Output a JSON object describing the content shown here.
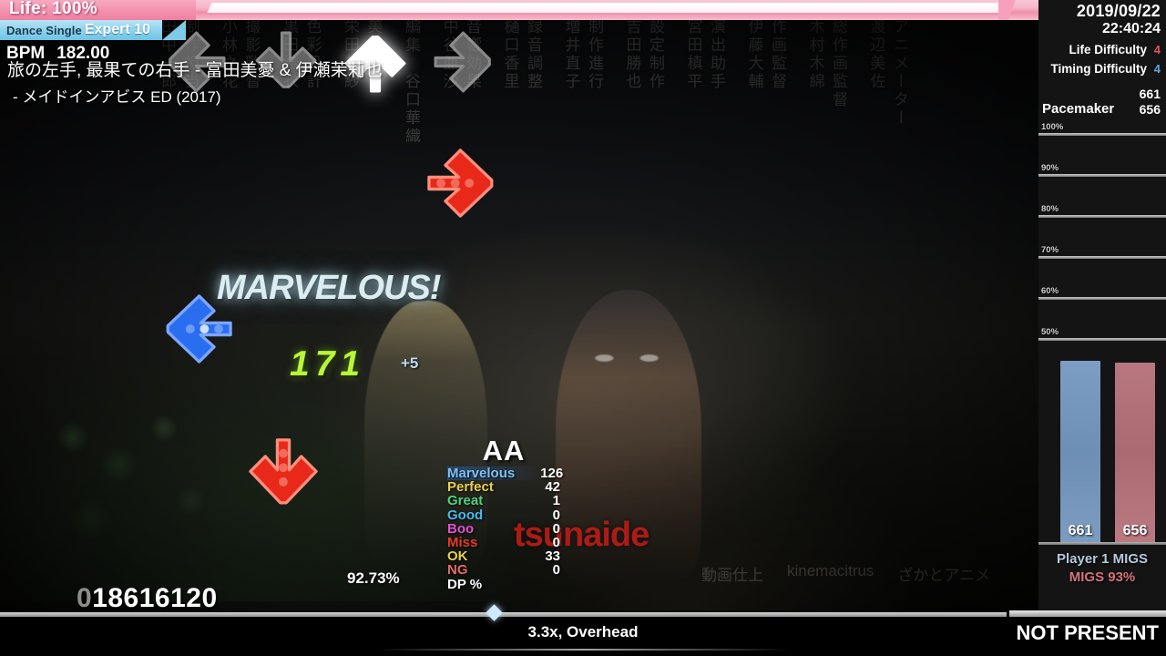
{
  "life": {
    "label": "Life: 100%",
    "percent": 100
  },
  "meta": {
    "mode": "Dance Single",
    "difficulty": "Expert 10",
    "bpm_label": "BPM",
    "bpm_value": "182.00",
    "song_title": "旅の左手, 最果ての右手 - 富田美憂 & 伊瀬茉莉也",
    "song_subtitle": "- メイドインアビス ED (2017)"
  },
  "gameplay": {
    "judgement": "MARVELOUS!",
    "combo": "171",
    "combo_bonus": "+5",
    "watermark": "tsunaide",
    "receptors": [
      "left-receptor",
      "down-receptor",
      "up-receptor",
      "right-receptor"
    ],
    "lit_receptor": "up-receptor",
    "notes": [
      {
        "name": "right-note",
        "color": "#ed2b18"
      },
      {
        "name": "left-note",
        "color": "#2a6ef0"
      },
      {
        "name": "down-note",
        "color": "#ed2b18"
      }
    ]
  },
  "judgements": {
    "grade": "AA",
    "rows": [
      {
        "label": "Marvelous",
        "value": "126",
        "color": "#7ec0f0",
        "highlight": true
      },
      {
        "label": "Perfect",
        "value": "42",
        "color": "#e8d04a",
        "highlight": false
      },
      {
        "label": "Great",
        "value": "1",
        "color": "#4fd47e",
        "highlight": false
      },
      {
        "label": "Good",
        "value": "0",
        "color": "#49b9e8",
        "highlight": false
      },
      {
        "label": "Boo",
        "value": "0",
        "color": "#e44fd0",
        "highlight": false
      },
      {
        "label": "Miss",
        "value": "0",
        "color": "#e83a28",
        "highlight": false
      },
      {
        "label": "OK",
        "value": "33",
        "color": "#e8d04a",
        "highlight": false
      },
      {
        "label": "NG",
        "value": "0",
        "color": "#e06a6a",
        "highlight": false
      },
      {
        "label": "DP %",
        "value": "",
        "color": "#ffffff",
        "highlight": false
      }
    ]
  },
  "score": {
    "lead_zero": "0",
    "digits": "18616120",
    "percent": "92.73%"
  },
  "footer": {
    "speed_mod": "3.3x, Overhead",
    "not_present": "NOT PRESENT",
    "progress_percent": 48.5
  },
  "sidebar": {
    "date": "2019/09/22",
    "time": "22:40:24",
    "life_difficulty_label": "Life Difficulty",
    "life_difficulty_value": "4",
    "life_difficulty_color": "#e0555f",
    "timing_difficulty_label": "Timing Difficulty",
    "timing_difficulty_value": "4",
    "timing_difficulty_color": "#58a8e0",
    "pacemaker_label": "Pacemaker",
    "pacemaker_top": "661",
    "pacemaker_bottom": "656",
    "player_label": "Player 1 MIGS",
    "migs_label": "MIGS 93%"
  },
  "chart_data": {
    "type": "bar",
    "title": "Pacemaker",
    "categories": [
      "Player 1 MIGS",
      "MIGS 93%"
    ],
    "values": [
      661,
      656
    ],
    "value_labels": [
      "661",
      "656"
    ],
    "colors": [
      "#7d9ec4",
      "#b9767e"
    ],
    "gridlines": [
      "100%",
      "90%",
      "80%",
      "70%",
      "60%",
      "50%"
    ],
    "gridline_values": [
      100,
      90,
      80,
      70,
      60,
      50
    ],
    "ylim": [
      0,
      100
    ],
    "ylabel": "",
    "xlabel": "",
    "grid": true,
    "legend": "none"
  },
  "credits": {
    "columns": [
      "制作担当\n田中一郎",
      "撮影監督\n小林之花",
      "色彩設計\n黒田結衣",
      "美術監督\n栄田美紗",
      "編集　谷口華織",
      "音響効果\n中谷亜沙",
      "録音調整\n樋口香里",
      "制作進行\n増井直子",
      "設定制作\n吉田勝也",
      "演出助手\n宮田槙平",
      "作画監督\n伊藤大輔",
      "総作画監督\n木村木綿",
      "アニメーター\n渡辺美佐"
    ],
    "bottom": [
      "動画仕上",
      "kinemacitrus",
      "ざかとアニメ"
    ]
  }
}
